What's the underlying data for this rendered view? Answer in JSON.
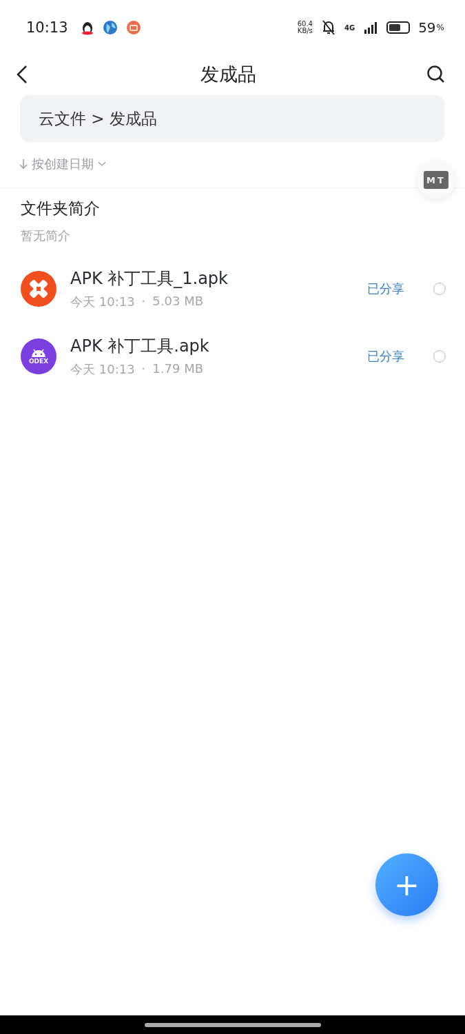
{
  "status_bar": {
    "time": "10:13",
    "speed_value": "60.4",
    "speed_unit": "KB/s",
    "network": "4G",
    "battery": "59",
    "battery_unit": "%"
  },
  "header": {
    "title": "发成品"
  },
  "breadcrumb": "云文件 > 发成品",
  "sort": {
    "label": "按创建日期"
  },
  "floating_app": {
    "label": "MT"
  },
  "folder_intro": {
    "title": "文件夹简介",
    "text": "暂无简介"
  },
  "files": [
    {
      "name": "APK 补丁工具_1.apk",
      "date": "今天 10:13",
      "separator": "·",
      "size": "5.03 MB",
      "status": "已分享",
      "kind": "patch",
      "selected": false
    },
    {
      "name": "APK 补丁工具.apk",
      "date": "今天 10:13",
      "separator": "·",
      "size": "1.79 MB",
      "status": "已分享",
      "kind": "odex",
      "icon_label": "ODEX",
      "selected": false
    }
  ],
  "fab": {
    "label": "+"
  }
}
